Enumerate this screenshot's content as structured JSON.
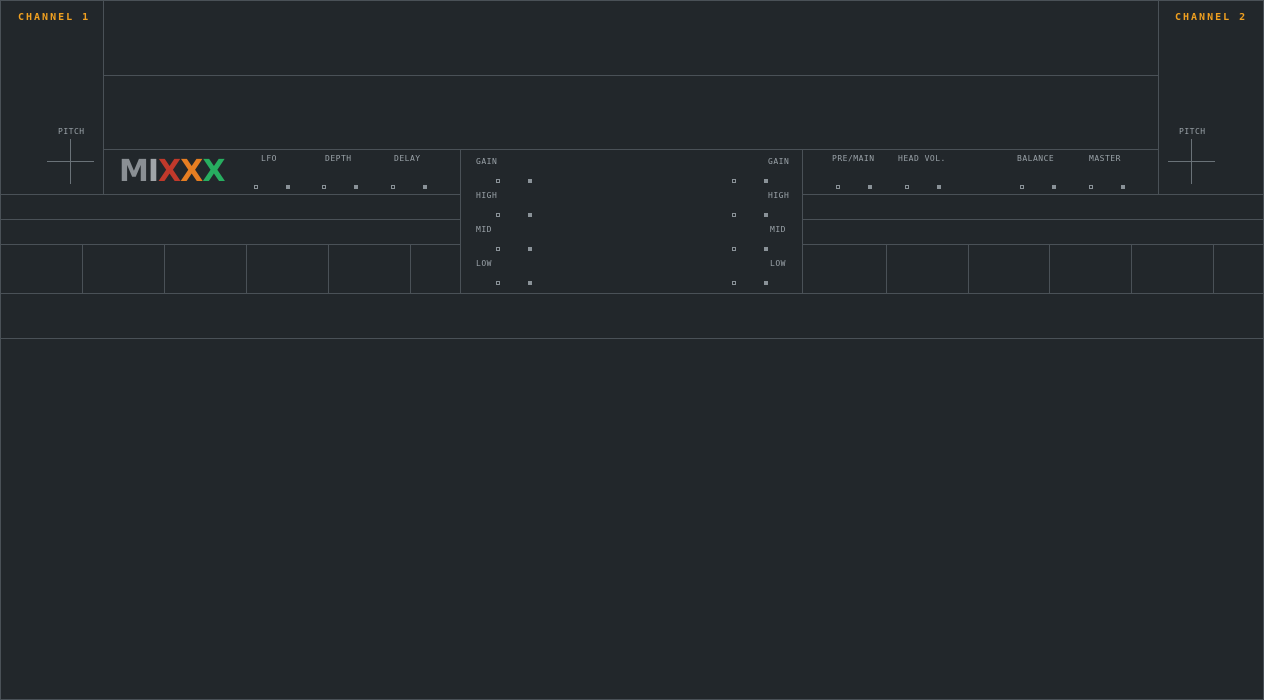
{
  "deck1": {
    "title": "CHANNEL 1",
    "pitch_label": "PITCH"
  },
  "deck2": {
    "title": "CHANNEL 2",
    "pitch_label": "PITCH"
  },
  "logo": {
    "letters": [
      "M",
      "I",
      "X",
      "X",
      "X"
    ]
  },
  "effects": {
    "lfo_label": "LFO",
    "depth_label": "DEPTH",
    "delay_label": "DELAY"
  },
  "eq_left": {
    "gain_label": "GAIN",
    "high_label": "HIGH",
    "mid_label": "MID",
    "low_label": "LOW"
  },
  "eq_right": {
    "gain_label": "GAIN",
    "high_label": "HIGH",
    "mid_label": "MID",
    "low_label": "LOW"
  },
  "master_section": {
    "pre_main_label": "PRE/MAIN",
    "head_vol_label": "HEAD VOL.",
    "balance_label": "BALANCE",
    "master_label": "MASTER"
  },
  "colors": {
    "background": "#22272b",
    "line": "#4a5157",
    "accent": "#f0a020"
  }
}
